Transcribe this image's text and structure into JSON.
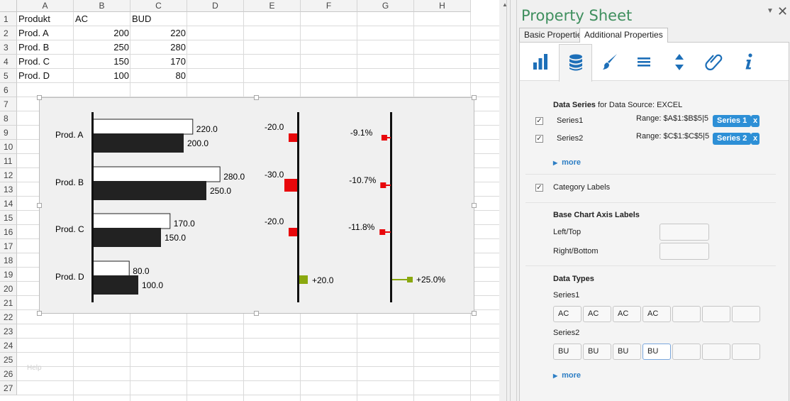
{
  "spreadsheet": {
    "columns": [
      "A",
      "B",
      "C",
      "D",
      "E",
      "F",
      "G",
      "H"
    ],
    "rows": [
      "1",
      "2",
      "3",
      "4",
      "5",
      "6",
      "7",
      "8",
      "9",
      "10",
      "11",
      "12",
      "13",
      "14",
      "15",
      "16",
      "17",
      "18",
      "19",
      "20",
      "21",
      "22",
      "23",
      "24",
      "25",
      "26",
      "27"
    ],
    "cells": {
      "A1": "Produkt",
      "B1": "AC",
      "C1": "BUD",
      "A2": "Prod. A",
      "B2": "200",
      "C2": "220",
      "A3": "Prod. B",
      "B3": "250",
      "C3": "280",
      "A4": "Prod. C",
      "B4": "150",
      "C4": "170",
      "A5": "Prod. D",
      "B5": "100",
      "C5": "80"
    },
    "faint_text": "Help"
  },
  "chart_data": {
    "type": "bar",
    "categories": [
      "Prod. A",
      "Prod. B",
      "Prod. C",
      "Prod. D"
    ],
    "series": [
      {
        "name": "",
        "values": [
          220,
          280,
          170,
          80
        ],
        "labels": [
          "220.0",
          "280.0",
          "170.0",
          "80.0"
        ]
      },
      {
        "name": "",
        "values": [
          200,
          250,
          150,
          100
        ],
        "labels": [
          "200.0",
          "250.0",
          "150.0",
          "100.0"
        ]
      }
    ],
    "abs_variance": [
      -20,
      -30,
      -20,
      20
    ],
    "abs_variance_labels": [
      "-20.0",
      "-30.0",
      "-20.0",
      "+20.0"
    ],
    "rel_variance": [
      -9.1,
      -10.7,
      -11.8,
      25.0
    ],
    "rel_variance_labels": [
      "-9.1%",
      "-10.7%",
      "-11.8%",
      "+25.0%"
    ],
    "colors": {
      "budget": "#ffffff",
      "actual": "#222222",
      "negative": "#e8070b",
      "positive": "#8aa80f"
    }
  },
  "property_sheet": {
    "title": "Property Sheet",
    "tabs": [
      "Basic Properties",
      "Additional Properties"
    ],
    "icon_tabs": [
      "bar-chart-icon",
      "database-icon",
      "brush-icon",
      "menu-icon",
      "sort-arrows-icon",
      "paperclip-icon",
      "info-icon"
    ],
    "data_series": {
      "heading_bold": "Data Series",
      "heading_rest": " for Data Source: EXCEL",
      "items": [
        {
          "name": "Series1",
          "range": "Range: $A$1:$B$5|5",
          "tag": "Series 1",
          "remove": "x"
        },
        {
          "name": "Series2",
          "range": "Range: $C$1:$C$5|5",
          "tag": "Series 2",
          "remove": "x"
        }
      ],
      "more": "more"
    },
    "category_labels": "Category Labels",
    "axis_labels": {
      "heading": "Base Chart Axis Labels",
      "left_top": "Left/Top",
      "right_bottom": "Right/Bottom"
    },
    "data_types": {
      "heading": "Data Types",
      "series1_label": "Series1",
      "series1_values": [
        "AC",
        "AC",
        "AC",
        "AC",
        "",
        "",
        ""
      ],
      "series2_label": "Series2",
      "series2_values": [
        "BU",
        "BU",
        "BU",
        "BU",
        "",
        "",
        ""
      ],
      "more": "more"
    },
    "accent_color": "#2d8fd6",
    "title_color": "#3f8f5e"
  }
}
